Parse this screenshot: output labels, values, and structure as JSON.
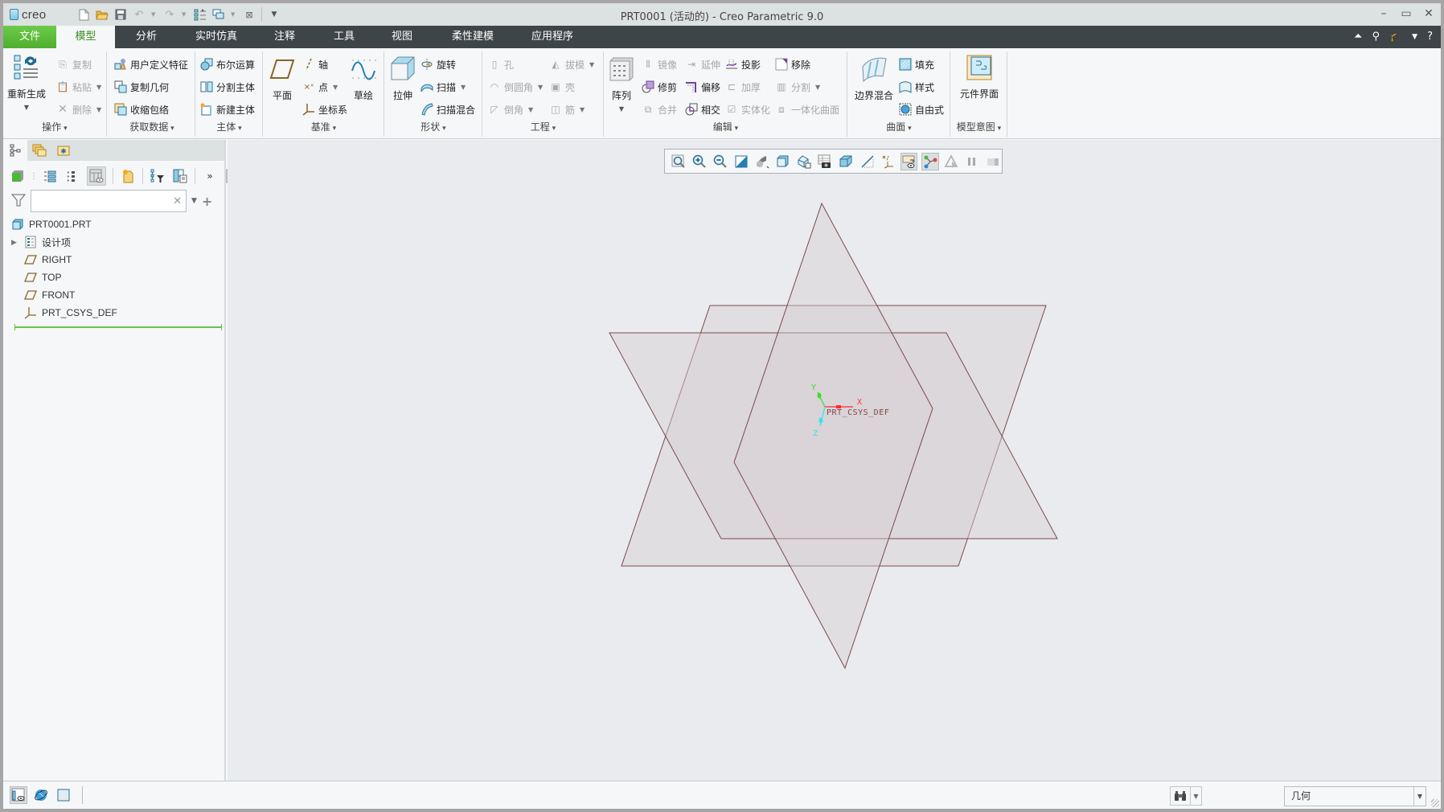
{
  "app": {
    "logo_text": "creo",
    "title": "PRT0001 (活动的) - Creo Parametric 9.0"
  },
  "quick_access": [
    "new",
    "open",
    "save",
    "undo",
    "redo",
    "regenerate",
    "windows",
    "close"
  ],
  "tabs": [
    {
      "label": "文件",
      "type": "file"
    },
    {
      "label": "模型",
      "active": true
    },
    {
      "label": "分析"
    },
    {
      "label": "实时仿真"
    },
    {
      "label": "注释"
    },
    {
      "label": "工具"
    },
    {
      "label": "视图"
    },
    {
      "label": "柔性建模"
    },
    {
      "label": "应用程序"
    }
  ],
  "ribbon": {
    "operations": {
      "label": "操作",
      "regenerate": "重新生成",
      "copy": "复制",
      "paste": "粘贴",
      "delete": "删除"
    },
    "get_data": {
      "label": "获取数据",
      "udf": "用户定义特征",
      "copy_geom": "复制几何",
      "shrinkwrap": "收缩包络"
    },
    "body": {
      "label": "主体",
      "boolean": "布尔运算",
      "split_body": "分割主体",
      "new_body": "新建主体"
    },
    "datum": {
      "label": "基准",
      "plane": "平面",
      "axis": "轴",
      "point": "点",
      "csys": "坐标系",
      "sketch": "草绘"
    },
    "shapes": {
      "label": "形状",
      "extrude": "拉伸",
      "revolve": "旋转",
      "sweep": "扫描",
      "swept_blend": "扫描混合"
    },
    "engineering": {
      "label": "工程",
      "hole": "孔",
      "draft": "拔模",
      "round": "倒圆角",
      "shell": "壳",
      "chamfer": "倒角",
      "rib": "筋"
    },
    "editing": {
      "label": "编辑",
      "pattern": "阵列",
      "mirror": "镜像",
      "extend": "延伸",
      "project": "投影",
      "remove": "移除",
      "trim": "修剪",
      "offset": "偏移",
      "thicken": "加厚",
      "split": "分割",
      "merge": "合并",
      "intersect": "相交",
      "solidify": "实体化",
      "unify": "一体化曲面"
    },
    "surfaces": {
      "label": "曲面",
      "boundary_blend": "边界混合",
      "fill": "填充",
      "style": "样式",
      "freestyle": "自由式"
    },
    "model_intent": {
      "label": "模型意图",
      "component_interface": "元件界面"
    }
  },
  "model_tree": {
    "filter_placeholder": "",
    "items": [
      {
        "label": "PRT0001.PRT",
        "icon": "part-icon"
      },
      {
        "label": "设计项",
        "icon": "design-items-icon",
        "expandable": true
      },
      {
        "label": "RIGHT",
        "icon": "datum-plane-icon"
      },
      {
        "label": "TOP",
        "icon": "datum-plane-icon"
      },
      {
        "label": "FRONT",
        "icon": "datum-plane-icon"
      },
      {
        "label": "PRT_CSYS_DEF",
        "icon": "csys-icon"
      }
    ]
  },
  "graphics": {
    "csys_label": "PRT_CSYS_DEF",
    "axis_x": "X",
    "axis_y": "Y",
    "axis_z": "Z",
    "plane_color": "#7a4a4a",
    "plane_fill": "#d8cfd3"
  },
  "status_bar": {
    "selection_filter": "几何"
  },
  "colors": {
    "tab_bar": "#3d4548",
    "file_tab": "#5bbd38",
    "active_tab_text": "#3b8c25",
    "background": "#e9ebee"
  }
}
